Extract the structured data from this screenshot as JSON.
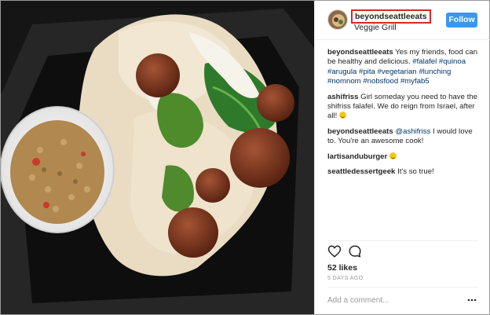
{
  "header": {
    "username": "beyondseattleeats",
    "location": "Veggie Grill",
    "follow_label": "Follow"
  },
  "caption": {
    "username": "beyondseattleeats",
    "text": " Yes my friends, food can be healthy and delicious. ",
    "hashtags": [
      "#falafel",
      "#quinoa",
      "#arugula",
      "#pita",
      "#vegetarian",
      "#lunching",
      "#nomnom",
      "#nobsfood",
      "#myfab5"
    ]
  },
  "comments": [
    {
      "username": "ashifriss",
      "text": " Girl someday you need to have the shifriss falafel. We do reign from Israel, after all! ",
      "emoji": "smiley-emoji"
    },
    {
      "username": "beyondseattleeats",
      "mention": "@ashifriss",
      "text": " I would love to. You're an awesome cook!"
    },
    {
      "username": "lartisanduburger",
      "text": " ",
      "emoji": "smiley-emoji"
    },
    {
      "username": "seattledessertgeek",
      "text": " It's so true!"
    }
  ],
  "likes": "52 likes",
  "timestamp": "5 DAYS AGO",
  "add_comment_placeholder": "Add a comment...",
  "icons": {
    "like": "heart-icon",
    "comment": "comment-bubble-icon",
    "more": "more-options-icon"
  },
  "colors": {
    "follow_button": "#3897f0",
    "hashtag": "#003569",
    "highlight_box": "#d8262b"
  }
}
